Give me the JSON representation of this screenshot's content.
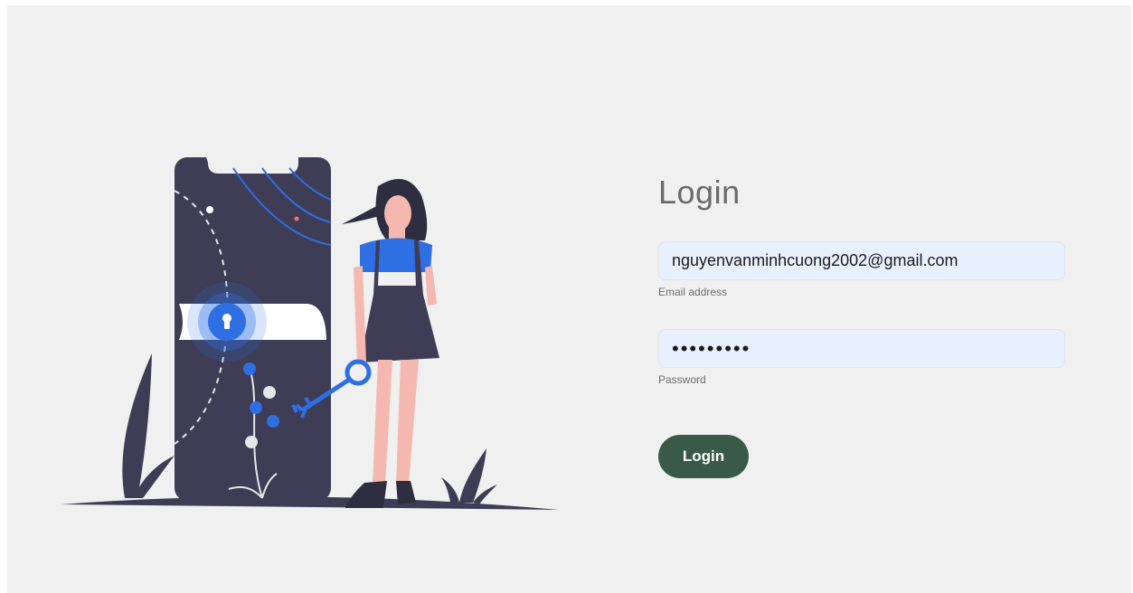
{
  "login": {
    "title": "Login",
    "email": {
      "value": "nguyenvanminhcuong2002@gmail.com",
      "label": "Email address"
    },
    "password": {
      "value": "•••••••••",
      "label": "Password"
    },
    "submit_label": "Login"
  },
  "colors": {
    "page_background": "#eff0ef",
    "input_background": "#e8effd",
    "button_background": "#3a5a49",
    "illustration_dark": "#3f3d56",
    "illustration_accent": "#2f6fe4",
    "skin": "#f4b8b0"
  },
  "icons": {
    "lock": "keyhole-lock-icon",
    "key": "key-icon"
  }
}
